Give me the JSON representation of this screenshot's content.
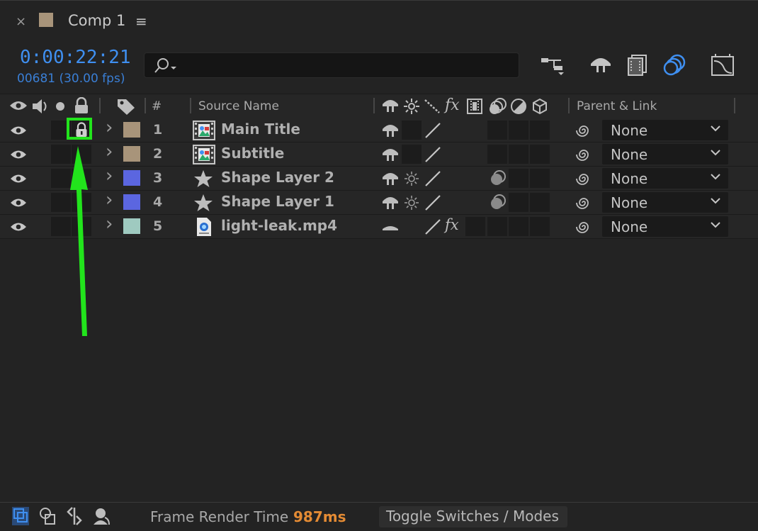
{
  "tab": {
    "close": "×",
    "title": "Comp 1",
    "menu": "≡",
    "swatch_color": "#a8947a"
  },
  "timecode": {
    "time": "0:00:22:21",
    "frames": "00681 (30.00 fps)"
  },
  "search": {
    "value": ""
  },
  "header": {
    "number": "#",
    "source_name": "Source Name",
    "parent_link": "Parent & Link",
    "fx": "fx"
  },
  "layers": [
    {
      "number": "1",
      "name": "Main Title",
      "type": "comp",
      "label_color": "#a8947a",
      "locked": true,
      "parent": "None",
      "fx": ""
    },
    {
      "number": "2",
      "name": "Subtitle",
      "type": "comp",
      "label_color": "#a8947a",
      "locked": false,
      "parent": "None",
      "fx": ""
    },
    {
      "number": "3",
      "name": "Shape Layer 2",
      "type": "shape",
      "label_color": "#5b66e0",
      "locked": false,
      "parent": "None",
      "fx": ""
    },
    {
      "number": "4",
      "name": "Shape Layer 1",
      "type": "shape",
      "label_color": "#5b66e0",
      "locked": false,
      "parent": "None",
      "fx": ""
    },
    {
      "number": "5",
      "name": "light-leak.mp4",
      "type": "footage",
      "label_color": "#9fcac0",
      "locked": false,
      "parent": "None",
      "fx": "fx"
    }
  ],
  "footer": {
    "frame_render_label": "Frame Render Time",
    "frame_render_value": "987ms",
    "toggle_label": "Toggle Switches / Modes"
  },
  "colors": {
    "accent_blue": "#3f8ff0",
    "highlight_green": "#22e41c",
    "render_orange": "#e48b34"
  }
}
